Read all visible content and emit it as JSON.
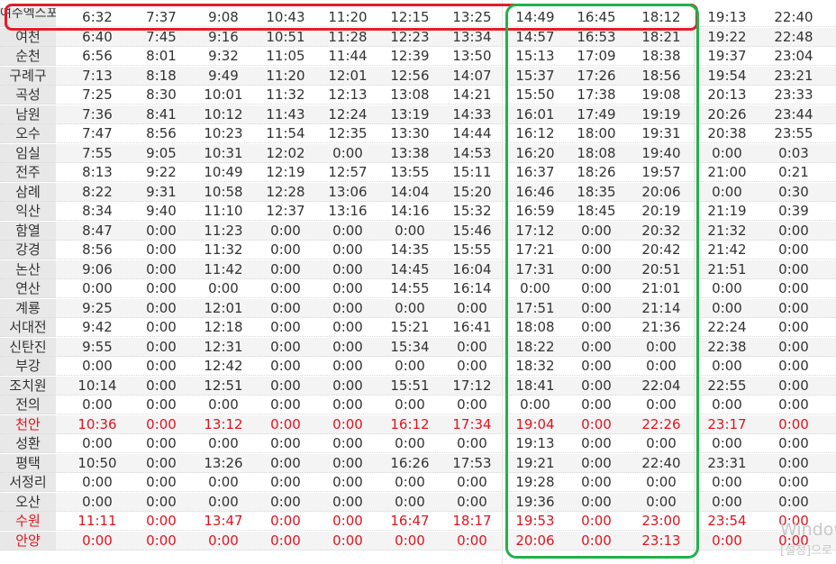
{
  "colors": {
    "text": "#333333",
    "highlight_text": "#e0141e",
    "red_box": "#e51d2a",
    "green_box": "#21b14a"
  },
  "timetable": {
    "rows": [
      {
        "station": "여수엑스포",
        "highlight": false,
        "times": [
          "6:32",
          "7:37",
          "9:08",
          "10:43",
          "11:20",
          "12:15",
          "13:25",
          "14:49",
          "16:45",
          "18:12",
          "19:13",
          "22:40"
        ]
      },
      {
        "station": "여천",
        "highlight": false,
        "times": [
          "6:40",
          "7:45",
          "9:16",
          "10:51",
          "11:28",
          "12:23",
          "13:34",
          "14:57",
          "16:53",
          "18:21",
          "19:22",
          "22:48"
        ]
      },
      {
        "station": "순천",
        "highlight": false,
        "times": [
          "6:56",
          "8:01",
          "9:32",
          "11:05",
          "11:44",
          "12:39",
          "13:50",
          "15:13",
          "17:09",
          "18:38",
          "19:37",
          "23:04"
        ]
      },
      {
        "station": "구례구",
        "highlight": false,
        "times": [
          "7:13",
          "8:18",
          "9:49",
          "11:20",
          "12:01",
          "12:56",
          "14:07",
          "15:37",
          "17:26",
          "18:56",
          "19:54",
          "23:21"
        ]
      },
      {
        "station": "곡성",
        "highlight": false,
        "times": [
          "7:25",
          "8:30",
          "10:01",
          "11:32",
          "12:13",
          "13:08",
          "14:21",
          "15:50",
          "17:38",
          "19:08",
          "20:13",
          "23:33"
        ]
      },
      {
        "station": "남원",
        "highlight": false,
        "times": [
          "7:36",
          "8:41",
          "10:12",
          "11:43",
          "12:24",
          "13:19",
          "14:33",
          "16:01",
          "17:49",
          "19:19",
          "20:26",
          "23:44"
        ]
      },
      {
        "station": "오수",
        "highlight": false,
        "times": [
          "7:47",
          "8:56",
          "10:23",
          "11:54",
          "12:35",
          "13:30",
          "14:44",
          "16:12",
          "18:00",
          "19:31",
          "20:38",
          "23:55"
        ]
      },
      {
        "station": "임실",
        "highlight": false,
        "times": [
          "7:55",
          "9:05",
          "10:31",
          "12:02",
          "0:00",
          "13:38",
          "14:53",
          "16:20",
          "18:08",
          "19:40",
          "0:00",
          "0:03"
        ]
      },
      {
        "station": "전주",
        "highlight": false,
        "times": [
          "8:13",
          "9:22",
          "10:49",
          "12:19",
          "12:57",
          "13:55",
          "15:11",
          "16:37",
          "18:26",
          "19:57",
          "21:00",
          "0:21"
        ]
      },
      {
        "station": "삼례",
        "highlight": false,
        "times": [
          "8:22",
          "9:31",
          "10:58",
          "12:28",
          "13:06",
          "14:04",
          "15:20",
          "16:46",
          "18:35",
          "20:06",
          "0:00",
          "0:30"
        ]
      },
      {
        "station": "익산",
        "highlight": false,
        "times": [
          "8:34",
          "9:40",
          "11:10",
          "12:37",
          "13:16",
          "14:16",
          "15:32",
          "16:59",
          "18:45",
          "20:19",
          "21:19",
          "0:39"
        ]
      },
      {
        "station": "함열",
        "highlight": false,
        "times": [
          "8:47",
          "0:00",
          "11:23",
          "0:00",
          "0:00",
          "0:00",
          "15:46",
          "17:12",
          "0:00",
          "20:32",
          "21:32",
          "0:00"
        ]
      },
      {
        "station": "강경",
        "highlight": false,
        "times": [
          "8:56",
          "0:00",
          "11:32",
          "0:00",
          "0:00",
          "14:35",
          "15:55",
          "17:21",
          "0:00",
          "20:42",
          "21:42",
          "0:00"
        ]
      },
      {
        "station": "논산",
        "highlight": false,
        "times": [
          "9:06",
          "0:00",
          "11:42",
          "0:00",
          "0:00",
          "14:45",
          "16:04",
          "17:31",
          "0:00",
          "20:51",
          "21:51",
          "0:00"
        ]
      },
      {
        "station": "연산",
        "highlight": false,
        "times": [
          "0:00",
          "0:00",
          "0:00",
          "0:00",
          "0:00",
          "14:55",
          "16:14",
          "0:00",
          "0:00",
          "21:01",
          "0:00",
          "0:00"
        ]
      },
      {
        "station": "계룡",
        "highlight": false,
        "times": [
          "9:25",
          "0:00",
          "12:01",
          "0:00",
          "0:00",
          "0:00",
          "0:00",
          "17:51",
          "0:00",
          "21:14",
          "0:00",
          "0:00"
        ]
      },
      {
        "station": "서대전",
        "highlight": false,
        "times": [
          "9:42",
          "0:00",
          "12:18",
          "0:00",
          "0:00",
          "15:21",
          "16:41",
          "18:08",
          "0:00",
          "21:36",
          "22:24",
          "0:00"
        ]
      },
      {
        "station": "신탄진",
        "highlight": false,
        "times": [
          "9:55",
          "0:00",
          "12:31",
          "0:00",
          "0:00",
          "15:34",
          "0:00",
          "18:22",
          "0:00",
          "0:00",
          "22:38",
          "0:00"
        ]
      },
      {
        "station": "부강",
        "highlight": false,
        "times": [
          "0:00",
          "0:00",
          "12:42",
          "0:00",
          "0:00",
          "0:00",
          "0:00",
          "18:32",
          "0:00",
          "0:00",
          "0:00",
          "0:00"
        ]
      },
      {
        "station": "조치원",
        "highlight": false,
        "times": [
          "10:14",
          "0:00",
          "12:51",
          "0:00",
          "0:00",
          "15:51",
          "17:12",
          "18:41",
          "0:00",
          "22:04",
          "22:55",
          "0:00"
        ]
      },
      {
        "station": "전의",
        "highlight": false,
        "times": [
          "0:00",
          "0:00",
          "0:00",
          "0:00",
          "0:00",
          "0:00",
          "0:00",
          "0:00",
          "0:00",
          "0:00",
          "0:00",
          "0:00"
        ]
      },
      {
        "station": "천안",
        "highlight": true,
        "times": [
          "10:36",
          "0:00",
          "13:12",
          "0:00",
          "0:00",
          "16:12",
          "17:34",
          "19:04",
          "0:00",
          "22:26",
          "23:17",
          "0:00"
        ]
      },
      {
        "station": "성환",
        "highlight": false,
        "times": [
          "0:00",
          "0:00",
          "0:00",
          "0:00",
          "0:00",
          "0:00",
          "0:00",
          "19:13",
          "0:00",
          "0:00",
          "0:00",
          "0:00"
        ]
      },
      {
        "station": "평택",
        "highlight": false,
        "times": [
          "10:50",
          "0:00",
          "13:26",
          "0:00",
          "0:00",
          "16:26",
          "17:53",
          "19:21",
          "0:00",
          "22:40",
          "23:31",
          "0:00"
        ]
      },
      {
        "station": "서정리",
        "highlight": false,
        "times": [
          "0:00",
          "0:00",
          "0:00",
          "0:00",
          "0:00",
          "0:00",
          "0:00",
          "19:28",
          "0:00",
          "0:00",
          "0:00",
          "0:00"
        ]
      },
      {
        "station": "오산",
        "highlight": false,
        "times": [
          "0:00",
          "0:00",
          "0:00",
          "0:00",
          "0:00",
          "0:00",
          "0:00",
          "19:36",
          "0:00",
          "0:00",
          "0:00",
          "0:00"
        ]
      },
      {
        "station": "수원",
        "highlight": true,
        "times": [
          "11:11",
          "0:00",
          "13:47",
          "0:00",
          "0:00",
          "16:47",
          "18:17",
          "19:53",
          "0:00",
          "23:00",
          "23:54",
          "0:00"
        ]
      },
      {
        "station": "안양",
        "highlight": true,
        "times": [
          "0:00",
          "0:00",
          "0:00",
          "0:00",
          "0:00",
          "0:00",
          "0:00",
          "20:06",
          "0:00",
          "23:13",
          "0:00",
          "0:00"
        ]
      }
    ]
  },
  "overlay": {
    "watermark_line1": "Window",
    "watermark_line2": "[설정]으로"
  }
}
